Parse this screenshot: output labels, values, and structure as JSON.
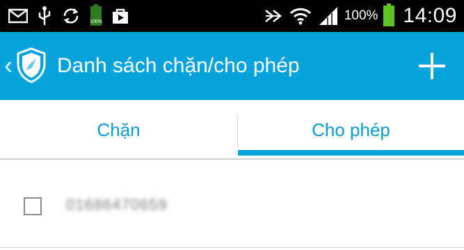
{
  "status_bar": {
    "icons_left": [
      "mail-icon",
      "usb-icon",
      "sync-icon",
      "battery-small-icon",
      "bag-icon"
    ],
    "battery_small_label": "100%",
    "icons_right": [
      "nfc-icon",
      "wifi-icon",
      "signal-icon"
    ],
    "battery_percent": "100%",
    "time": "14:09"
  },
  "app_bar": {
    "back_glyph": "‹",
    "title": "Danh sách chặn/cho phép",
    "logo": "shield-icon",
    "add_icon": "plus-icon",
    "background_color": "#08a3dc"
  },
  "tabs": [
    {
      "label": "Chặn",
      "selected": false
    },
    {
      "label": "Cho phép",
      "selected": true
    }
  ],
  "list": {
    "items": [
      {
        "checked": false,
        "text": "01686470659"
      }
    ]
  },
  "colors": {
    "accent": "#08a3dc",
    "tab_text": "#0a9ad4",
    "status_bar": "#000000"
  }
}
